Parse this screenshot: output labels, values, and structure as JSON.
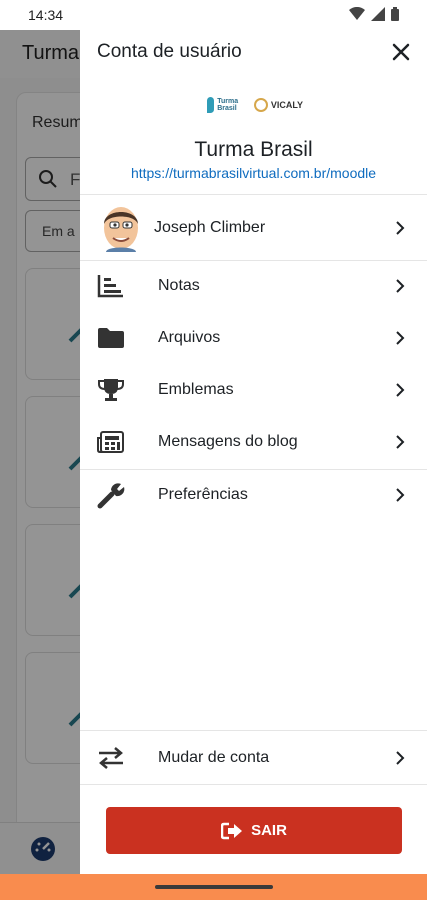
{
  "status_bar": {
    "time": "14:34"
  },
  "background": {
    "title": "Turma",
    "section_label": "Resum",
    "search_placeholder": "F",
    "filter_text": "Em a"
  },
  "drawer": {
    "title": "Conta de usuário",
    "site": {
      "logo_text_1": "Turma Brasil",
      "logo_text_2": "VICALY",
      "name": "Turma Brasil",
      "url": "https://turmabrasilvirtual.com.br/moodle"
    },
    "user": {
      "name": "Joseph Climber"
    },
    "menu": [
      {
        "label": "Notas",
        "icon": "grades-icon"
      },
      {
        "label": "Arquivos",
        "icon": "folder-icon"
      },
      {
        "label": "Emblemas",
        "icon": "trophy-icon"
      },
      {
        "label": "Mensagens do blog",
        "icon": "blog-icon"
      },
      {
        "label": "Preferências",
        "icon": "wrench-icon"
      }
    ],
    "switch_account": "Mudar de conta",
    "logout": "SAIR"
  },
  "colors": {
    "logout": "#ca3120",
    "link": "#0f6cbf",
    "nav_bar": "#f98c4e"
  }
}
